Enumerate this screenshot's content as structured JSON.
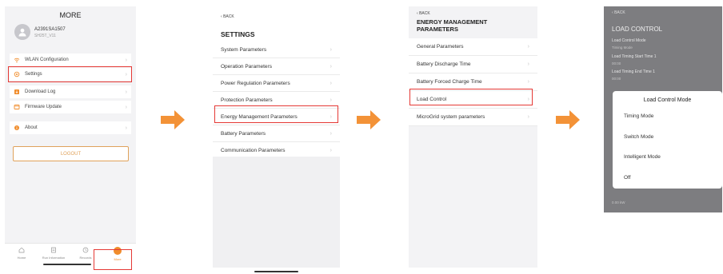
{
  "screen1": {
    "title": "MORE",
    "device_id": "A2391SA1507",
    "device_model": "SH25T_V11",
    "menu": [
      {
        "label": "WLAN Configuration",
        "icon": "wifi-icon"
      },
      {
        "label": "Settings",
        "icon": "gear-icon"
      },
      {
        "label": "Download Log",
        "icon": "download-icon"
      },
      {
        "label": "Firmware Update",
        "icon": "firmware-icon"
      },
      {
        "label": "About",
        "icon": "info-icon"
      }
    ],
    "logout": "LOGOUT",
    "tabs": [
      {
        "label": "Home",
        "icon": "home-icon"
      },
      {
        "label": "Run Information",
        "icon": "document-icon"
      },
      {
        "label": "Records",
        "icon": "clock-icon"
      },
      {
        "label": "More",
        "icon": "more-icon"
      }
    ],
    "active_tab": "More",
    "highlighted": [
      "Settings",
      "More"
    ]
  },
  "screen2": {
    "back": "BACK",
    "title": "SETTINGS",
    "items": [
      "System Parameters",
      "Operation Parameters",
      "Power Regulation Parameters",
      "Protection Parameters",
      "Energy Management Parameters",
      "Battery Parameters",
      "Communication Parameters"
    ],
    "highlighted": "Energy Management Parameters"
  },
  "screen3": {
    "back": "BACK",
    "title_line1": "ENERGY MANAGEMENT",
    "title_line2": "PARAMETERS",
    "items": [
      "General Parameters",
      "Battery Discharge Time",
      "Battery Forced Charge Time",
      "Load Control",
      "MicroGrid system parameters"
    ],
    "highlighted": "Load Control"
  },
  "screen4": {
    "back": "BACK",
    "title": "LOAD CONTROL",
    "fields": [
      {
        "label": "Load Control Mode",
        "value": "Timing Mode"
      },
      {
        "label": "Load Timing Start Time 1",
        "value": "00:00"
      },
      {
        "label": "Load Timing End Time 1",
        "value": "00:00"
      }
    ],
    "bottom_value": "0.00 kW",
    "modal": {
      "title": "Load Control Mode",
      "options": [
        "Timing Mode",
        "Switch Mode",
        "Intelligent Mode",
        "Off"
      ]
    }
  },
  "colors": {
    "accent": "#f08c2b",
    "arrow": "#f39237",
    "highlight": "#e53935",
    "overlay": "#7d7d80"
  }
}
